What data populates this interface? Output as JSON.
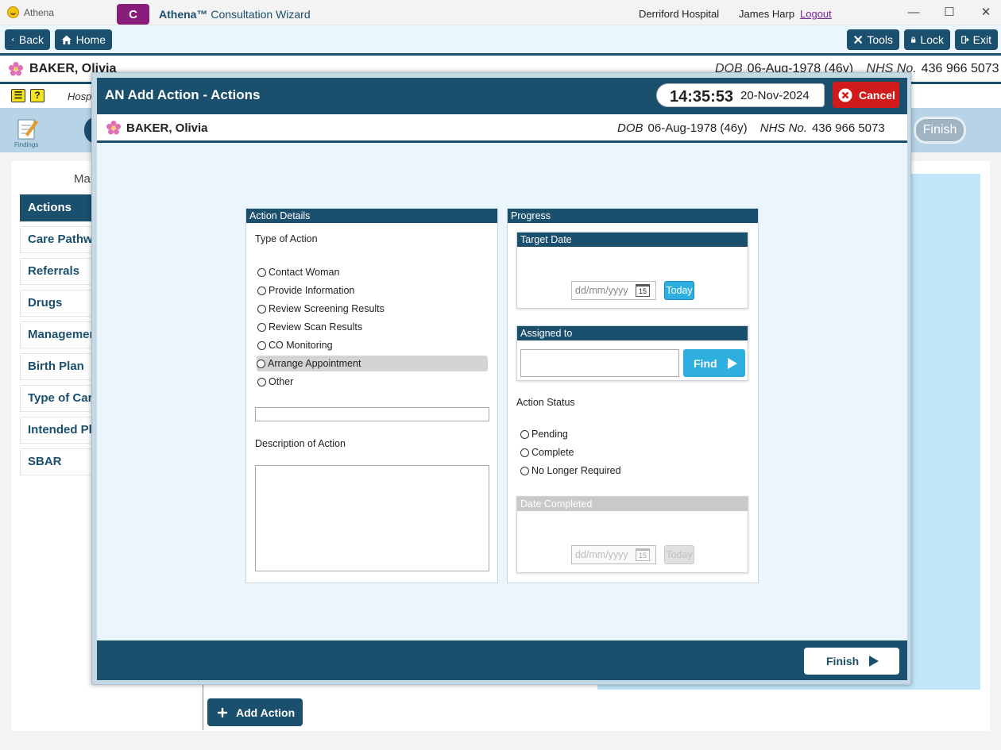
{
  "window": {
    "title": "Athena",
    "minimize": "—",
    "maximize": "☐",
    "close": "✕"
  },
  "toolbar": {
    "back": "Back",
    "home": "Home",
    "c_badge": "C",
    "app_name": "Athena™",
    "app_subtitle": "Consultation Wizard",
    "hospital": "Derriford Hospital",
    "user": "James Harp",
    "logout": "Logout",
    "tools": "Tools",
    "lock": "Lock",
    "exit": "Exit"
  },
  "patient": {
    "name": "BAKER, Olivia",
    "dob_label": "DOB",
    "dob": "06-Aug-1978 (46y)",
    "nhs_label": "NHS No.",
    "nhs": "436 966 5073"
  },
  "background": {
    "hosp_text": "Hospi",
    "findings_label": "Findings",
    "ma_text": "Mai",
    "finish": "Finish",
    "nav": [
      "Actions",
      "Care Pathway",
      "Referrals",
      "Drugs",
      "Management",
      "Birth Plan",
      "Type of Care",
      "Intended Place",
      "SBAR"
    ],
    "active_nav": "Actions",
    "add_action": "Add Action"
  },
  "modal": {
    "title": "AN Add Action - Actions",
    "time": "14:35:53",
    "date": "20-Nov-2024",
    "cancel": "Cancel",
    "finish": "Finish",
    "action_details": {
      "header": "Action Details",
      "type_label": "Type of Action",
      "options": [
        "Contact Woman",
        "Provide Information",
        "Review Screening Results",
        "Review Scan Results",
        "CO Monitoring",
        "Arrange Appointment",
        "Other"
      ],
      "highlighted": "Arrange Appointment",
      "other_value": "",
      "description_label": "Description of Action",
      "description_value": ""
    },
    "progress": {
      "header": "Progress",
      "target_date": {
        "header": "Target Date",
        "placeholder": "dd/mm/yyyy",
        "today": "Today",
        "cal_num": "15"
      },
      "assigned_to": {
        "header": "Assigned to",
        "value": "",
        "find": "Find"
      },
      "status_label": "Action Status",
      "status_options": [
        "Pending",
        "Complete",
        "No Longer Required"
      ],
      "date_completed": {
        "header": "Date Completed",
        "placeholder": "dd/mm/yyyy",
        "today": "Today",
        "cal_num": "15"
      }
    }
  },
  "colors": {
    "primary": "#1b4f6e",
    "accent": "#2eafe0",
    "cancel": "#d11a1a",
    "badge": "#8a1c7c"
  }
}
